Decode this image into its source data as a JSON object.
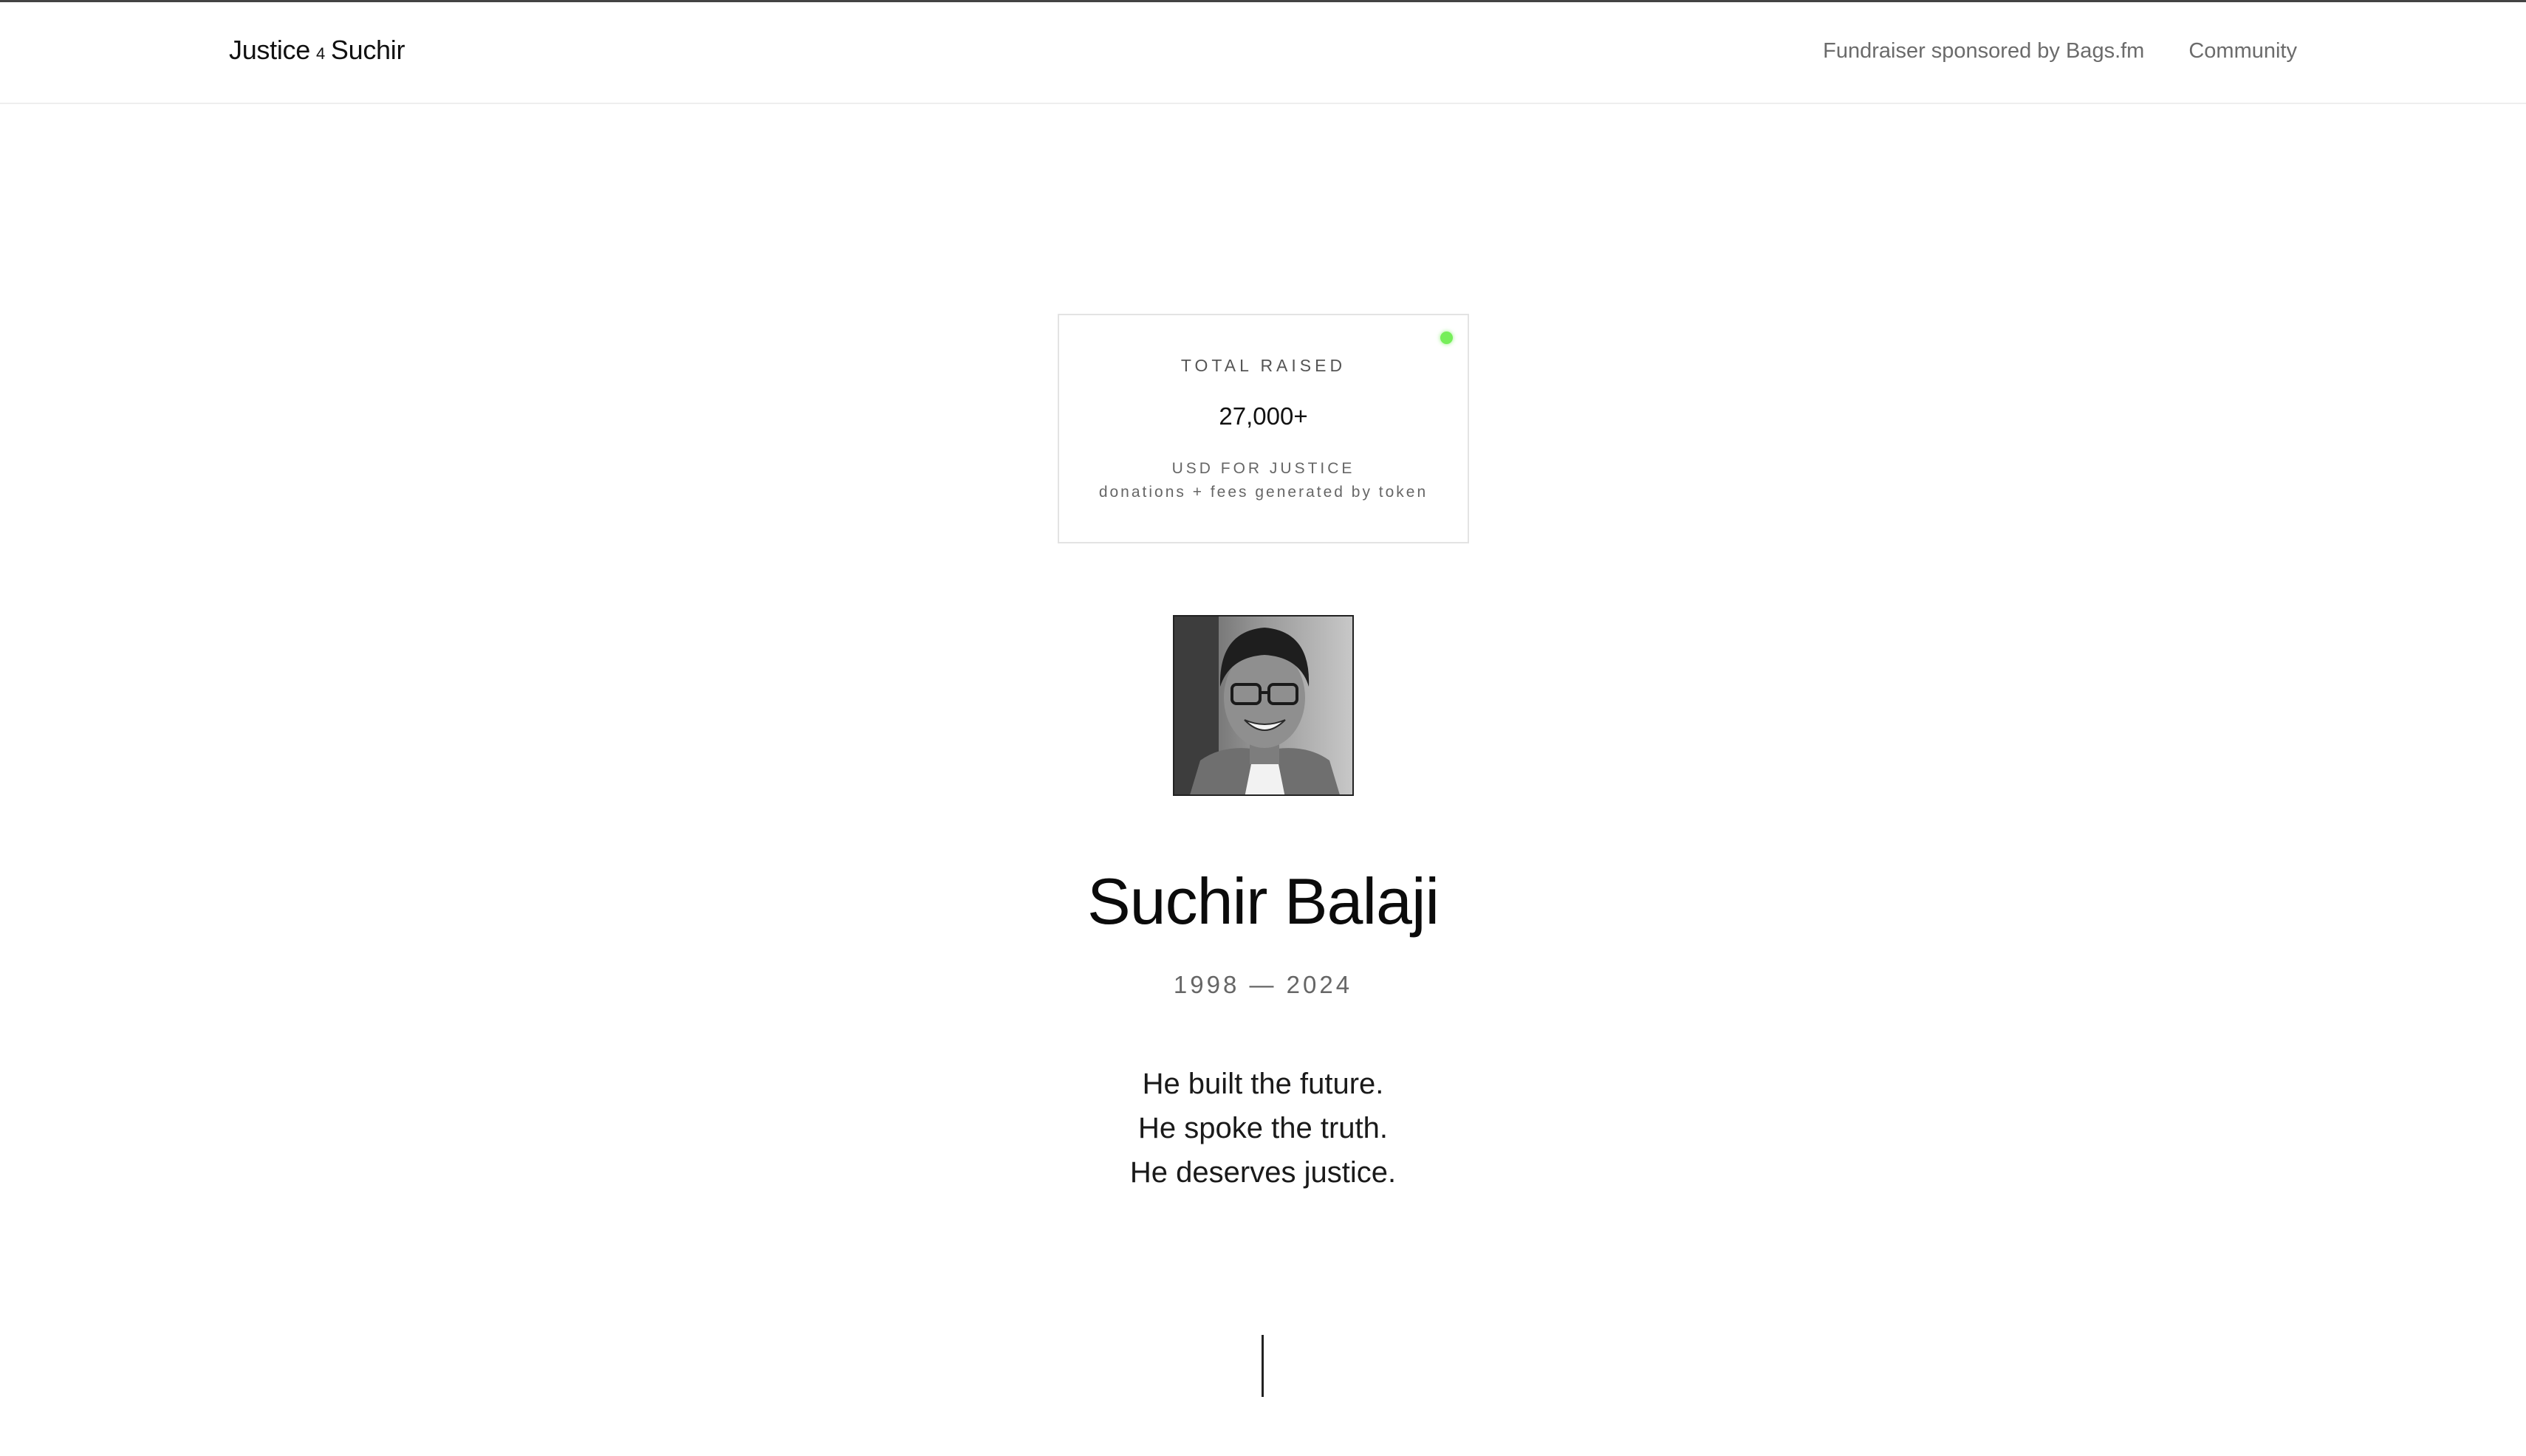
{
  "header": {
    "brand_left": "Justice",
    "brand_mid": "4",
    "brand_right": "Suchir",
    "nav": {
      "sponsor": "Fundraiser sponsored by Bags.fm",
      "community": "Community"
    }
  },
  "fundraiser": {
    "label": "TOTAL RAISED",
    "amount": "27,000+",
    "unit": "USD FOR JUSTICE",
    "note": "donations + fees generated by token",
    "live_color": "#76ee5a"
  },
  "memorial": {
    "name": "Suchir Balaji",
    "years": "1998 — 2024",
    "lines": [
      "He built the future.",
      "He spoke the truth.",
      "He deserves justice."
    ]
  },
  "icons": {
    "live": "status-dot-icon",
    "scroll": "scroll-indicator"
  }
}
